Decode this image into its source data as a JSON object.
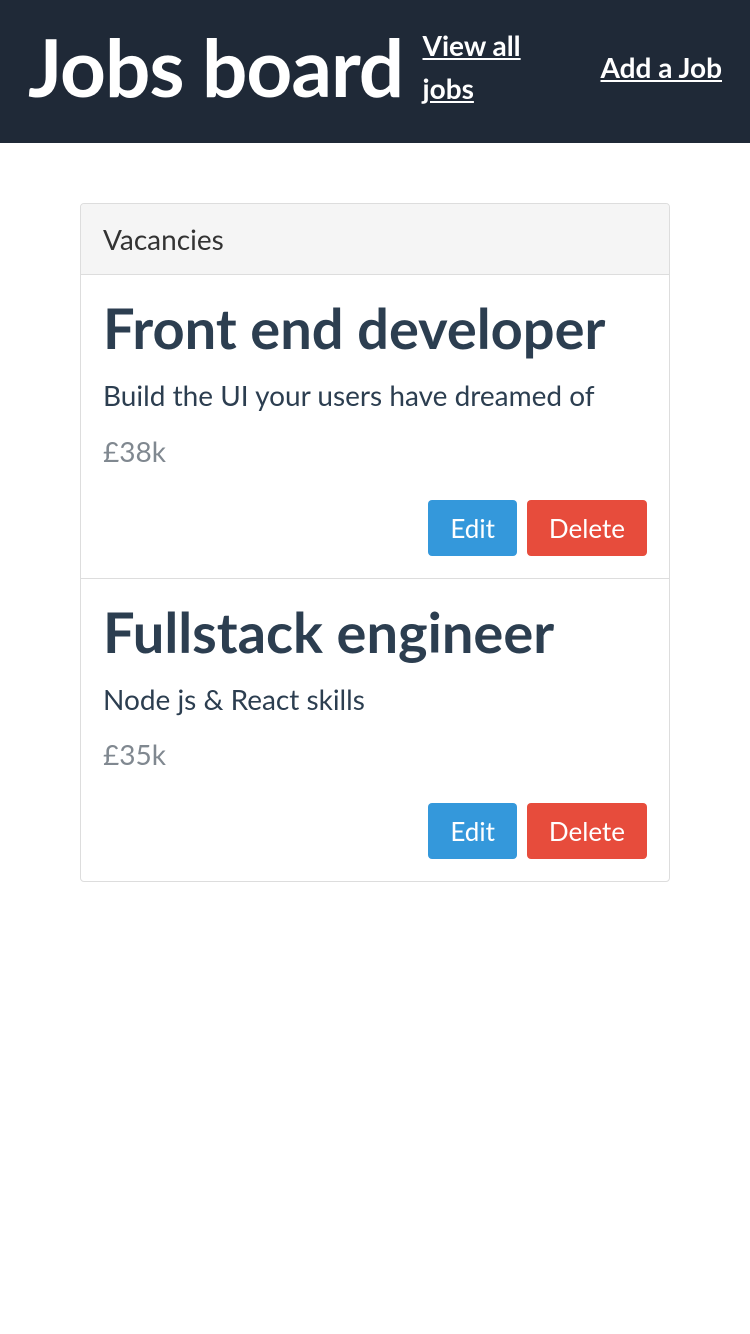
{
  "header": {
    "title": "Jobs board",
    "nav": {
      "view_all": "View all jobs",
      "add_job": "Add a Job"
    }
  },
  "panel": {
    "heading": "Vacancies"
  },
  "jobs": [
    {
      "title": "Front end developer",
      "description": "Build the UI your users have dreamed of",
      "salary": "£38k",
      "edit_label": "Edit",
      "delete_label": "Delete"
    },
    {
      "title": "Fullstack engineer",
      "description": "Node js & React skills",
      "salary": "£35k",
      "edit_label": "Edit",
      "delete_label": "Delete"
    }
  ]
}
